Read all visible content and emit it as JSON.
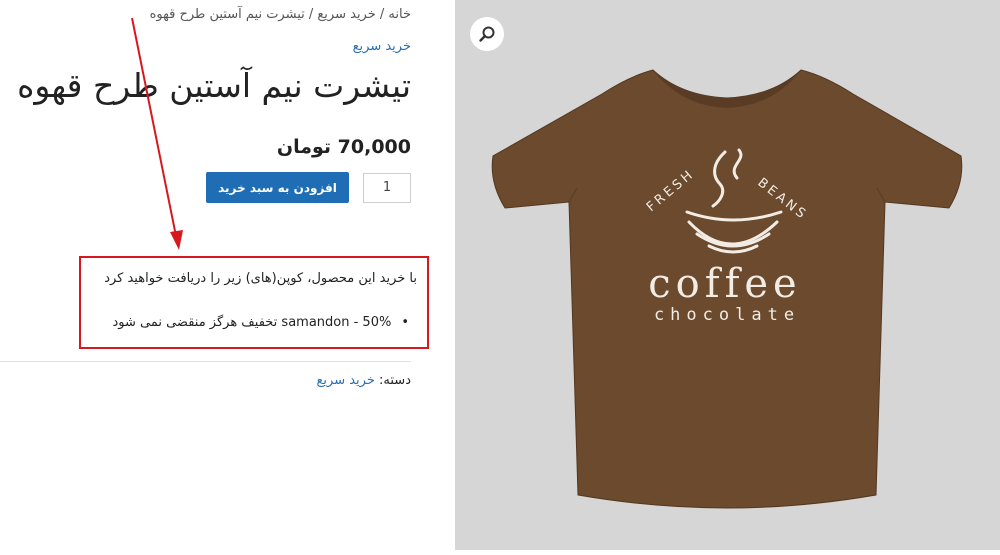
{
  "breadcrumb": {
    "text": "خانه / خرید سریع / تیشرت نیم آستین طرح قهوه"
  },
  "product": {
    "category_link": "خرید سریع",
    "title": "تیشرت نیم آستین طرح قهوه",
    "price": "70,000 تومان",
    "quantity": "1",
    "add_to_cart": "افزودن به سبد خرید"
  },
  "coupon": {
    "intro": "با خرید این محصول، کوپن(های) زیر را دریافت خواهید کرد",
    "items": [
      "samandon - 50% تخفیف هرگز منقضی نمی شود"
    ]
  },
  "meta": {
    "category_label": "دسته:",
    "category_value": "خرید سریع"
  },
  "gallery": {
    "zoom_icon": "magnifier-icon",
    "shirt_color": "#6b4a2e",
    "logo": {
      "arc_left": "FRESH",
      "arc_right": "BEANS",
      "word": "coffee",
      "subword": "chocolate"
    }
  },
  "annotation": {
    "color": "#d7191f"
  }
}
